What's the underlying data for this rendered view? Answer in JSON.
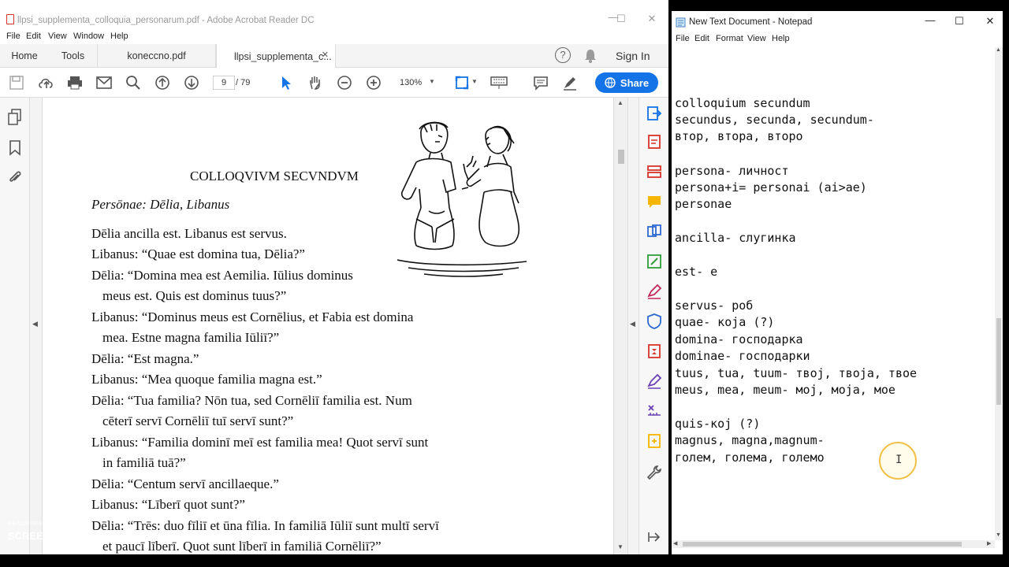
{
  "acrobat": {
    "title": "llpsi_supplementa_colloquia_personarum.pdf - Adobe Acrobat Reader DC",
    "menu": [
      "File",
      "Edit",
      "View",
      "Window",
      "Help"
    ],
    "tabs": {
      "home": "Home",
      "tools": "Tools",
      "doc1": "koneccno.pdf",
      "doc2": "llpsi_supplementa_c..."
    },
    "sign_in": "Sign In",
    "page_current": "9",
    "page_total": "/ 79",
    "zoom": "130%",
    "share": "Share"
  },
  "document": {
    "heading": "COLLOQVIVM SECVNDVM",
    "personae": "Persōnae: Dēlia, Libanus",
    "lines": [
      "Dēlia ancilla est. Libanus est servus.",
      "Libanus: “Quae est domina tua, Dēlia?”",
      "Dēlia: “Domina mea est Aemilia. Iūlius dominus",
      "meus est. Quis est dominus tuus?”",
      "Libanus: “Dominus meus est Cornēlius, et Fabia est domina",
      "mea. Estne magna familia Iūliī?”",
      "Dēlia: “Est magna.”",
      "Libanus: “Mea quoque familia magna est.”",
      "Dēlia: “Tua familia? Nōn tua, sed Cornēliī familia est. Num",
      "cēterī servī Cornēliī tuī servī sunt?”",
      "Libanus: “Familia dominī meī est familia mea! Quot servī sunt",
      "in familiā tuā?”",
      "Dēlia: “Centum servī ancillaeque.”",
      "Libanus: “Līberī quot sunt?”",
      "Dēlia: “Trēs: duo fīliī et ūna fīlia. In familiā Iūliī sunt multī servī",
      "et paucī līberī. Quot sunt līberī in familiā Cornēliī?”"
    ]
  },
  "notepad": {
    "title": "New Text Document - Notepad",
    "menu": [
      "File",
      "Edit",
      "Format",
      "View",
      "Help"
    ],
    "lines": [
      "colloquium secundum",
      "secundus, secunda, secundum-",
      "втор, втора, второ",
      "",
      "persona- личност",
      "persona+i= personai (ai>ae)",
      "personae",
      "",
      "ancilla- слугинка",
      "",
      "est- е",
      "",
      "servus- роб",
      "quae- која (?)",
      "domina- господарка",
      "dominae- господарки",
      "tuus, tua, tuum- твој, твоја, твое",
      "meus, mea, meum- мој, моја, мое",
      "",
      "quis-кој (?)",
      "magnus, magna,magnum-",
      "голем, голема, големо"
    ]
  },
  "watermark": {
    "line1": "RECORDED WITH",
    "line2": "SCREENCAST",
    "line3": "MATIC"
  },
  "colors": {
    "share_blue": "#1473e6",
    "acrobat_red": "#d8342c",
    "cursor_ring": "#f2c14a"
  }
}
